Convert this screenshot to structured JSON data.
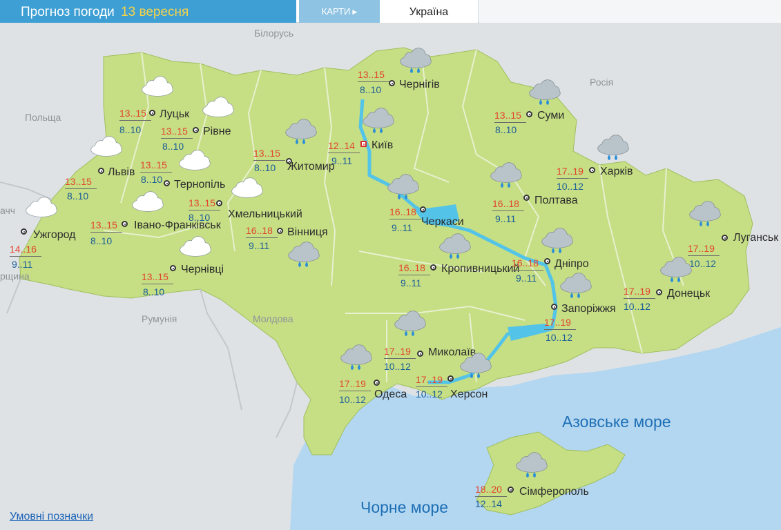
{
  "header": {
    "title": "Прогноз погоди",
    "date": "13 вересня",
    "maps_button": "КАРТИ",
    "region_tab": "Україна"
  },
  "map": {
    "countries": [
      {
        "id": "belarus",
        "label": "Білорусь"
      },
      {
        "id": "russia",
        "label": "Росія"
      },
      {
        "id": "poland",
        "label": "Польща"
      },
      {
        "id": "romania",
        "label": "Румунія"
      },
      {
        "id": "moldova",
        "label": "Молдова"
      },
      {
        "id": "slovakia-partial",
        "label": "ачч"
      },
      {
        "id": "hungary-partial",
        "label": "рщина"
      }
    ],
    "seas": [
      {
        "id": "azov",
        "label": "Азовське море"
      },
      {
        "id": "black",
        "label": "Чорне море"
      }
    ],
    "cities": [
      {
        "id": "lutsk",
        "name": "Луцьк",
        "day": "13..15",
        "night": "8..10",
        "icon": "cloudy"
      },
      {
        "id": "rivne",
        "name": "Рівне",
        "day": "13..15",
        "night": "8..10",
        "icon": "cloudy"
      },
      {
        "id": "lviv",
        "name": "Львів",
        "day": "13..15",
        "night": "8..10",
        "icon": "cloudy"
      },
      {
        "id": "ternopil",
        "name": "Тернопіль",
        "day": "13..15",
        "night": "8..10",
        "icon": "cloudy"
      },
      {
        "id": "uzhhorod",
        "name": "Ужгород",
        "day": "14..16",
        "night": "9..11",
        "icon": "cloudy"
      },
      {
        "id": "ivano-frankivsk",
        "name": "Івано-Франківськ",
        "day": "13..15",
        "night": "8..10",
        "icon": "cloudy"
      },
      {
        "id": "chernivtsi",
        "name": "Чернівці",
        "day": "13..15",
        "night": "8..10",
        "icon": "cloudy"
      },
      {
        "id": "khmelnytskyi",
        "name": "Хмельницький",
        "day": "13..15",
        "night": "8..10",
        "icon": "cloudy"
      },
      {
        "id": "zhytomyr",
        "name": "Житомир",
        "day": "13..15",
        "night": "8..10",
        "icon": "rain"
      },
      {
        "id": "vinnytsia",
        "name": "Вінниця",
        "day": "16..18",
        "night": "9..11",
        "icon": "rain"
      },
      {
        "id": "chernihiv",
        "name": "Чернігів",
        "day": "13..15",
        "night": "8..10",
        "icon": "rain"
      },
      {
        "id": "kyiv",
        "name": "Київ",
        "day": "12..14",
        "night": "9..11",
        "icon": "rain",
        "capital": true
      },
      {
        "id": "sumy",
        "name": "Суми",
        "day": "13..15",
        "night": "8..10",
        "icon": "rain"
      },
      {
        "id": "kharkiv",
        "name": "Харків",
        "day": "17..19",
        "night": "10..12",
        "icon": "rain"
      },
      {
        "id": "poltava",
        "name": "Полтава",
        "day": "16..18",
        "night": "9..11",
        "icon": "rain"
      },
      {
        "id": "cherkasy",
        "name": "Черкаси",
        "day": "16..18",
        "night": "9..11",
        "icon": "rain"
      },
      {
        "id": "kropyvnytskyi",
        "name": "Кропивницький",
        "day": "16..18",
        "night": "9..11",
        "icon": "rain"
      },
      {
        "id": "dnipro",
        "name": "Дніпро",
        "day": "16..18",
        "night": "9..11",
        "icon": "rain"
      },
      {
        "id": "luhansk",
        "name": "Луганськ",
        "day": "17..19",
        "night": "10..12",
        "icon": "rain"
      },
      {
        "id": "donetsk",
        "name": "Донецьк",
        "day": "17..19",
        "night": "10..12",
        "icon": "rain"
      },
      {
        "id": "zaporizhzhia",
        "name": "Запоріжжя",
        "day": "17..19",
        "night": "10..12",
        "icon": "rain"
      },
      {
        "id": "mykolaiv",
        "name": "Миколаїв",
        "day": "17..19",
        "night": "10..12",
        "icon": "rain"
      },
      {
        "id": "odesa",
        "name": "Одеса",
        "day": "17..19",
        "night": "10..12",
        "icon": "rain"
      },
      {
        "id": "kherson",
        "name": "Херсон",
        "day": "17..19",
        "night": "10..12",
        "icon": "rain"
      },
      {
        "id": "simferopol",
        "name": "Сімферополь",
        "day": "18..20",
        "night": "12..14",
        "icon": "rain"
      }
    ]
  },
  "legend_link": "Умовні позначки",
  "colors": {
    "header_blue": "#3d9fd3",
    "date_yellow": "#f7d447",
    "land": "#c6de84",
    "sea": "#b3d7f1",
    "day_temp": "#e1462e",
    "night_temp": "#1b5e99",
    "capital_marker": "#d62e2e"
  }
}
